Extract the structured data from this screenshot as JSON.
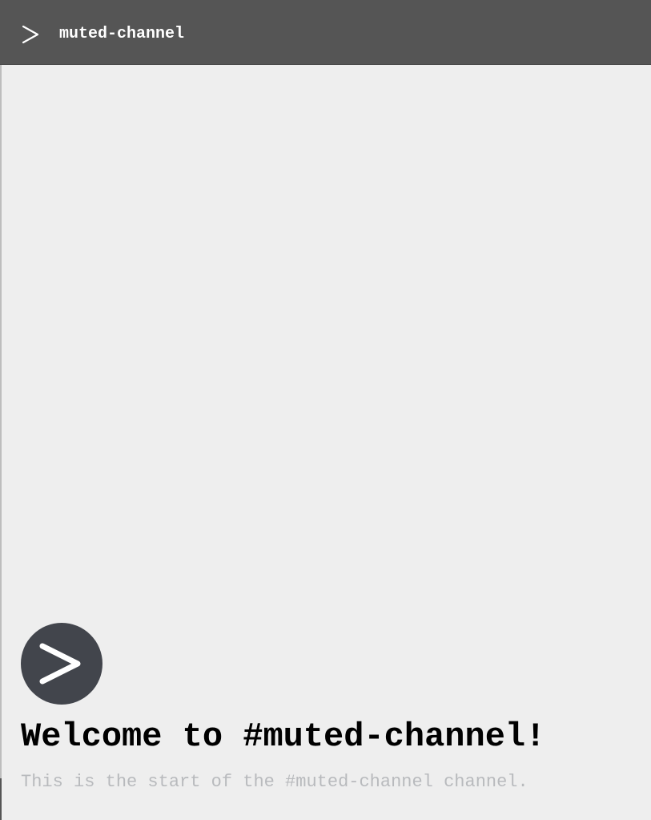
{
  "header": {
    "icon": "chevron-right-icon",
    "title": "muted-channel",
    "background": "#555555"
  },
  "main": {
    "avatar_icon": "chevron-right-icon",
    "avatar_background": "#42454c",
    "welcome_title": "Welcome to #muted-channel!",
    "start_text": "This is the start of the #muted-channel channel."
  }
}
